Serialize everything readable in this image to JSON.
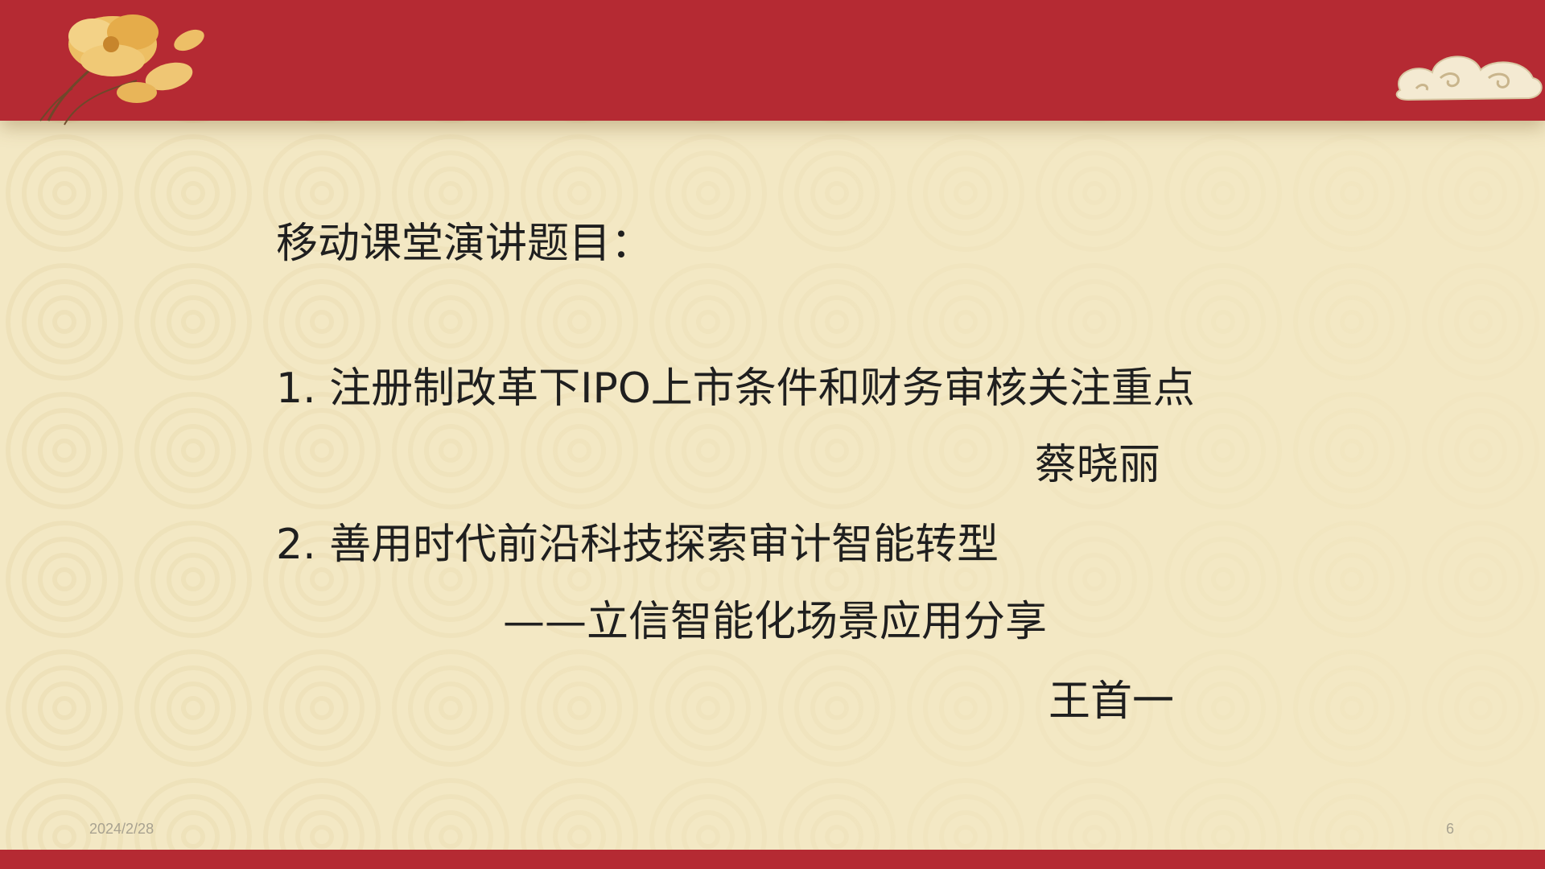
{
  "slide": {
    "heading": "移动课堂演讲题目：",
    "items": [
      {
        "title": "1. 注册制改革下IPO上市条件和财务审核关注重点",
        "author": "蔡晓丽"
      },
      {
        "title": "2. 善用时代前沿科技探索审计智能转型",
        "subtitle": "——立信智能化场景应用分享",
        "author": "王首一"
      }
    ],
    "footer": {
      "date": "2024/2/28",
      "page_number": "6"
    }
  },
  "decorations": {
    "top_left": "flower-icon",
    "top_right": "auspicious-cloud-icon"
  },
  "colors": {
    "band_red": "#b52a33",
    "background_cream": "#f3e8c4",
    "text": "#1f1f1f",
    "footer_text": "#a8a290"
  }
}
